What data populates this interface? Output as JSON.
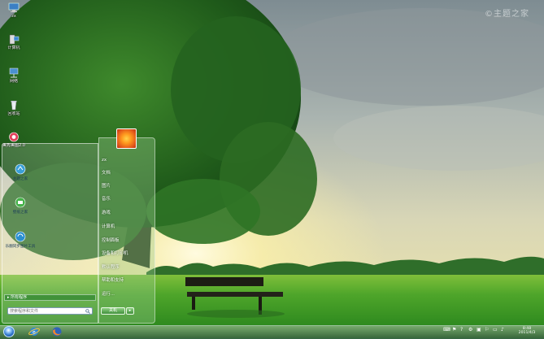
{
  "desktop": {
    "icons": [
      {
        "label": "zx"
      },
      {
        "label": "计算机"
      },
      {
        "label": "网络"
      },
      {
        "label": "回收站"
      },
      {
        "label": "美秀美图2.0"
      }
    ],
    "watermark": "©主题之家"
  },
  "start_menu": {
    "pinned": [
      {
        "label": "主题之家"
      },
      {
        "label": "壁纸之家"
      },
      {
        "label": "乐翻同步图片工具"
      }
    ],
    "all_programs_label": "所有程序",
    "search": {
      "placeholder": "搜索程序和文件"
    },
    "right_items": [
      {
        "label": "zx"
      },
      {
        "label": "文档"
      },
      {
        "label": "图片"
      },
      {
        "label": "音乐"
      },
      {
        "label": "游戏"
      },
      {
        "label": "计算机"
      },
      {
        "label": "控制面板"
      },
      {
        "label": "设备和打印机"
      },
      {
        "label": "默认程序"
      },
      {
        "label": "帮助和支持"
      },
      {
        "label": "运行..."
      }
    ],
    "shutdown_label": "关机",
    "shutdown_arrow": "▸"
  },
  "taskbar": {
    "pinned_apps": [
      {
        "icon": "internet-explorer-icon"
      },
      {
        "icon": "firefox-icon"
      }
    ],
    "clock": {
      "time": "8:48",
      "date": "2011/4/3"
    }
  },
  "colors": {
    "taskbar": "#2f6a3c",
    "sky": "#a7b3a6",
    "grass": "#3f9a2a"
  }
}
